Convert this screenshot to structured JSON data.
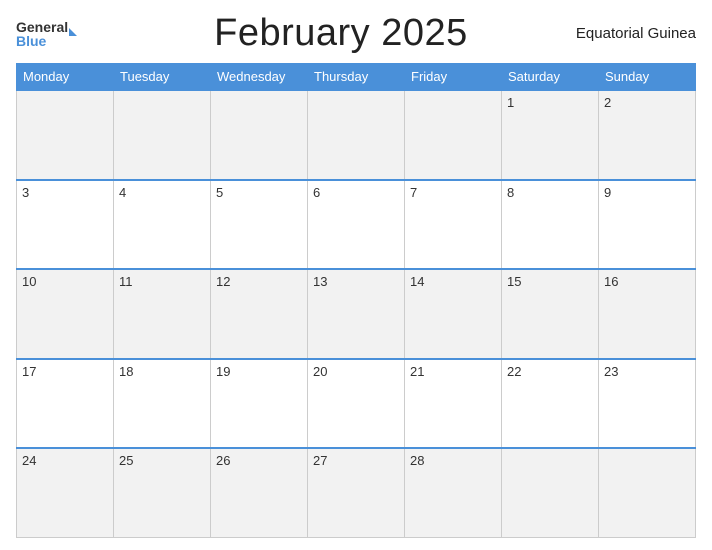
{
  "header": {
    "title": "February 2025",
    "country": "Equatorial Guinea",
    "logo_general": "General",
    "logo_blue": "Blue"
  },
  "weekdays": [
    "Monday",
    "Tuesday",
    "Wednesday",
    "Thursday",
    "Friday",
    "Saturday",
    "Sunday"
  ],
  "weeks": [
    [
      null,
      null,
      null,
      null,
      null,
      1,
      2
    ],
    [
      3,
      4,
      5,
      6,
      7,
      8,
      9
    ],
    [
      10,
      11,
      12,
      13,
      14,
      15,
      16
    ],
    [
      17,
      18,
      19,
      20,
      21,
      22,
      23
    ],
    [
      24,
      25,
      26,
      27,
      28,
      null,
      null
    ]
  ]
}
